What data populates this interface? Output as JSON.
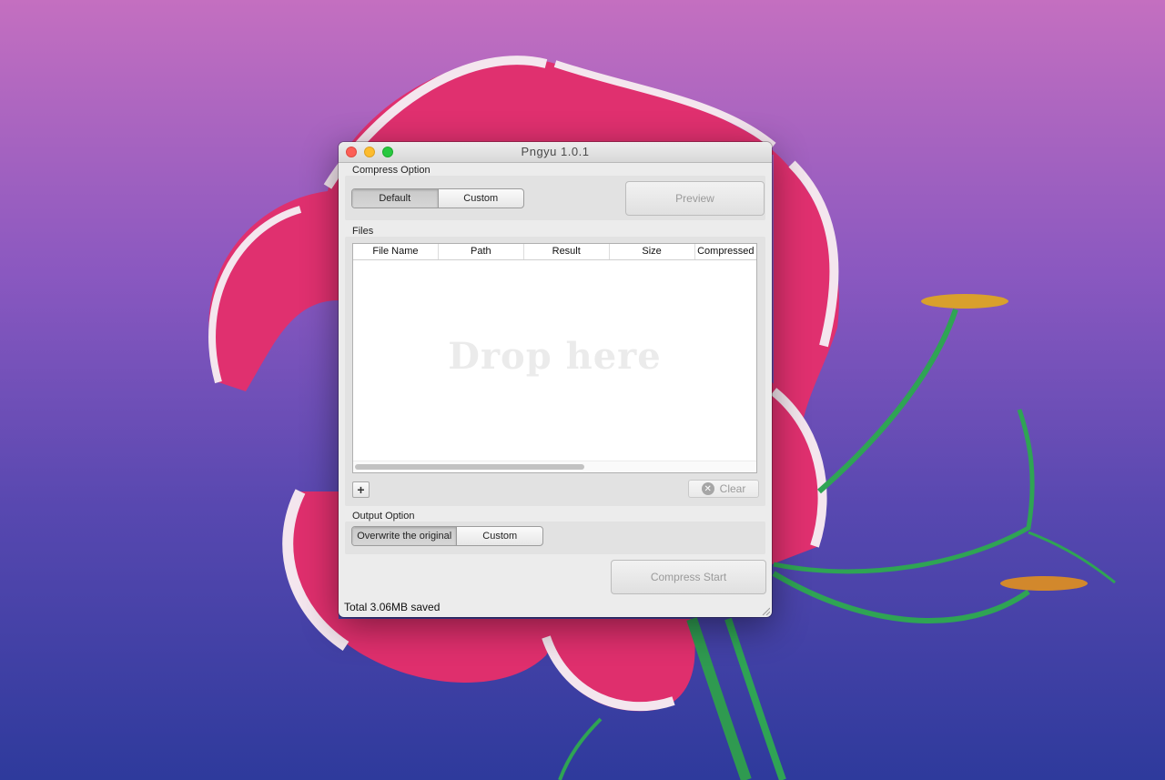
{
  "window": {
    "title": "Pngyu 1.0.1"
  },
  "compress_option": {
    "label": "Compress Option",
    "default_label": "Default",
    "custom_label": "Custom",
    "preview_label": "Preview"
  },
  "files": {
    "label": "Files",
    "columns": [
      "File Name",
      "Path",
      "Result",
      "Size",
      "Compressed"
    ],
    "drop_hint": "Drop here",
    "add_symbol": "+",
    "clear_label": "Clear"
  },
  "output_option": {
    "label": "Output Option",
    "overwrite_label": "Overwrite the original",
    "custom_label": "Custom"
  },
  "compress_start_label": "Compress Start",
  "status_text": "Total 3.06MB saved",
  "colors": {
    "close": "#fc5f57",
    "minimize": "#fdbc2e",
    "maximize": "#28c840"
  }
}
